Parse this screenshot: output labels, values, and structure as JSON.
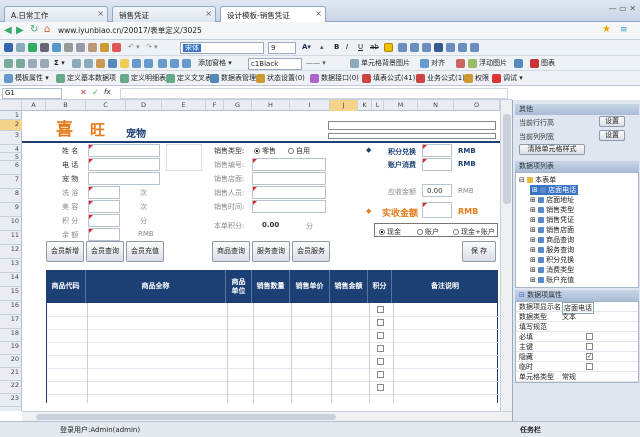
{
  "tabs": [
    {
      "label": "A.日常工作"
    },
    {
      "label": "销售凭证"
    },
    {
      "label": "设计模板-销售凭证"
    }
  ],
  "address": {
    "url": "www.iyunbiao.cn/20017/表单定义/3025"
  },
  "toolbar1": {
    "font_name": "宋体",
    "font_size": "9",
    "bold": "B",
    "italic": "I",
    "underline": "U",
    "strike": "ab"
  },
  "toolbar2": {
    "template": "模板属性",
    "items": [
      "定义基本数据项",
      "定义明细表",
      "定义文叉表",
      "数据表管理",
      "状态设置(0)",
      "数据接口(0)",
      "填表公式(41)",
      "业务公式(1)",
      "权限",
      "调试"
    ],
    "nav": "添加窗格",
    "border_style": "c1Black",
    "merge": "单元格背景图片",
    "align": "对齐",
    "float": "浮动图片",
    "chart": "图表"
  },
  "formula": {
    "cell_ref": "G1",
    "fx": "fx"
  },
  "columns": [
    "A",
    "B",
    "C",
    "D",
    "E",
    "F",
    "G",
    "H",
    "I",
    "J",
    "K",
    "L",
    "M",
    "N",
    "O"
  ],
  "rows": [
    "1",
    "2",
    "3",
    "4",
    "5",
    "6",
    "7",
    "8",
    "9",
    "10",
    "11",
    "12",
    "13",
    "14",
    "15",
    "16",
    "17",
    "18",
    "19",
    "20",
    "21",
    "22",
    "23",
    "24",
    "25"
  ],
  "form": {
    "title_char1": "喜",
    "title_char2": "旺",
    "subtitle": "宠物",
    "member_labels": [
      "姓  名",
      "电  话",
      "宠  物",
      "洗  浴",
      "美  容",
      "积  分",
      "余  额"
    ],
    "unit_ci": "次",
    "unit_fen": "分",
    "unit_rmb_small": "RMB",
    "sale_type_label": "销售类型:",
    "sale_type_opt1": "零售",
    "sale_type_opt2": "自用",
    "sale_no": "销售编号:",
    "sale_store": "销售店面:",
    "sale_person": "销售人员:",
    "sale_time": "销售时间:",
    "points_label": "本单积分:",
    "points_value": "0.00",
    "points_unit": "分",
    "diamond": "◆",
    "points_exchange": "积分兑换",
    "account_spend": "账户消费",
    "rmb": "RMB",
    "receivable": "应收金额",
    "receivable_value": "0.00",
    "receivable_unit": "RMB",
    "actual_amount": "实收金额",
    "actual_unit": "RMB",
    "pay_cash": "现金",
    "pay_account": "账户",
    "pay_mixed": "现金+账户"
  },
  "buttons": {
    "member_add": "会员新增",
    "member_query": "会员查询",
    "member_recharge": "会员充值",
    "goods_query": "商品查询",
    "service_query": "服务查询",
    "member_service": "会员服务",
    "save": "保 存"
  },
  "table": {
    "headers": [
      "商品代码",
      "商品全称",
      "商品\n单位",
      "销售数量",
      "销售单价",
      "销售金额",
      "积分",
      "备注说明"
    ]
  },
  "panel": {
    "other_title": "其他",
    "row_count_label": "当前行行高",
    "col_count_label": "当前列列宽",
    "set_btn": "设置",
    "clear_btn": "清除单元格样式",
    "tree_title": "数据项列表",
    "tree_root": "本表单",
    "tree_items": [
      "店面电话",
      "店面地址",
      "销售类型",
      "销售凭证",
      "销售店面",
      "商品查询",
      "服务查询",
      "积分兑换",
      "消费类型",
      "账户充值"
    ],
    "prop_title": "数据项属性",
    "props": [
      {
        "k": "数据项显示名",
        "v": "店面电话"
      },
      {
        "k": "数据类型",
        "v": "文本"
      },
      {
        "k": "填写规范",
        "v": ""
      },
      {
        "k": "必填",
        "v": ""
      },
      {
        "k": "主键",
        "v": ""
      },
      {
        "k": "隐藏",
        "v": ""
      },
      {
        "k": "临时",
        "v": ""
      },
      {
        "k": "单元格类型",
        "v": "常规"
      }
    ],
    "taskbar": "任务栏"
  },
  "status": {
    "user": "登录用户:Admin(admin)"
  }
}
